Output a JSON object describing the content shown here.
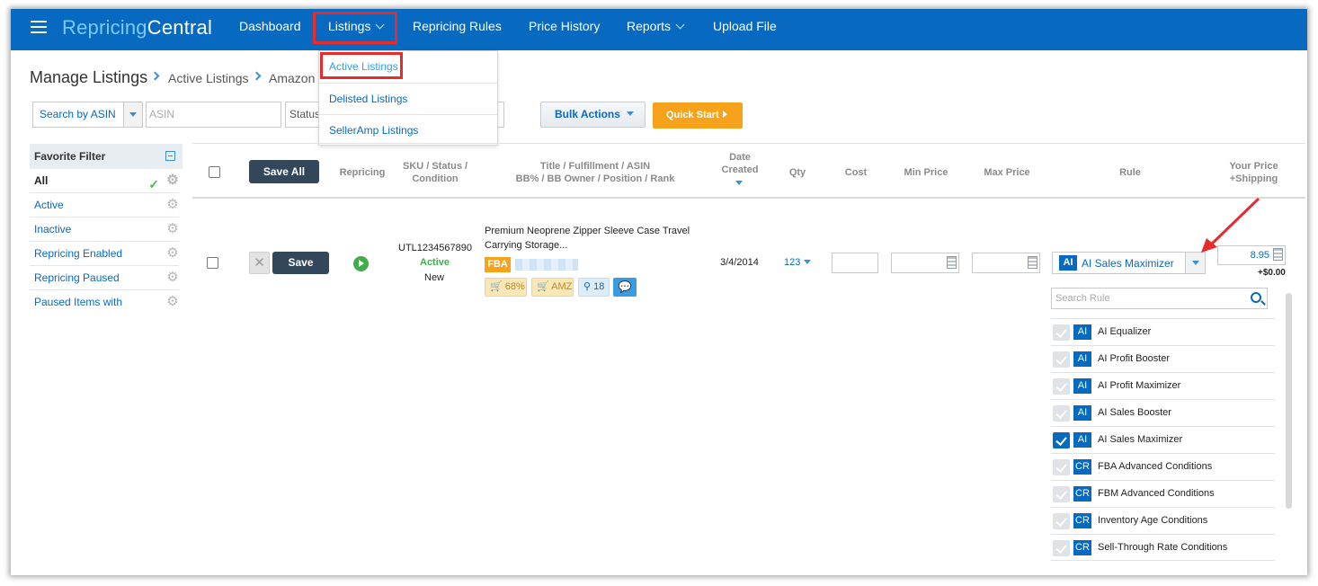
{
  "nav": {
    "logo_part1": "Repricing",
    "logo_part2": "Central",
    "items": [
      "Dashboard",
      "Listings",
      "Repricing Rules",
      "Price History",
      "Reports",
      "Upload File"
    ],
    "listings_dropdown": [
      "Active Listings",
      "Delisted Listings",
      "SellerAmp Listings"
    ]
  },
  "breadcrumb": {
    "title": "Manage Listings",
    "crumbs": [
      "Active Listings",
      "Amazon"
    ]
  },
  "filters": {
    "search_by": "Search by ASIN",
    "asin_placeholder": "ASIN",
    "status": "Status",
    "bulk_actions": "Bulk Actions",
    "quick_start": "Quick Start"
  },
  "favorites": {
    "title": "Favorite Filter",
    "items": [
      "All",
      "Active",
      "Inactive",
      "Repricing Enabled",
      "Repricing Paused",
      "Paused Items with"
    ]
  },
  "table": {
    "save_all": "Save All",
    "headers": {
      "repricing": "Repricing",
      "sku_status_1": "SKU / Status /",
      "sku_status_2": "Condition",
      "title_1": "Title / Fulfillment / ASIN",
      "title_2": "BB% / BB Owner / Position / Rank",
      "date_1": "Date",
      "date_2": "Created",
      "qty": "Qty",
      "cost": "Cost",
      "min_price": "Min Price",
      "max_price": "Max Price",
      "rule": "Rule",
      "price_1": "Your Price",
      "price_2": "+Shipping"
    },
    "row": {
      "save": "Save",
      "x": "✕",
      "sku": "UTL1234567890",
      "status": "Active",
      "condition": "New",
      "title_line1": "Premium Neoprene Zipper Sleeve Case Travel",
      "title_line2": "Carrying Storage...",
      "fulfillment": "FBA",
      "bb_pct": "68%",
      "bb_owner": "AMZ",
      "position": "18",
      "date_created": "3/4/2014",
      "qty": "123",
      "rule_badge": "AI",
      "rule": "AI Sales Maximizer",
      "price": "8.95",
      "shipping": "+$0.00"
    }
  },
  "rule_dropdown": {
    "search_placeholder": "Search Rule",
    "items": [
      {
        "badge": "AI",
        "label": "AI Equalizer",
        "checked": false
      },
      {
        "badge": "AI",
        "label": "AI Profit Booster",
        "checked": false
      },
      {
        "badge": "AI",
        "label": "AI Profit Maximizer",
        "checked": false
      },
      {
        "badge": "AI",
        "label": "AI Sales Booster",
        "checked": false
      },
      {
        "badge": "AI",
        "label": "AI Sales Maximizer",
        "checked": true
      },
      {
        "badge": "CR",
        "label": "FBA Advanced Conditions",
        "checked": false
      },
      {
        "badge": "CR",
        "label": "FBM Advanced Conditions",
        "checked": false
      },
      {
        "badge": "CR",
        "label": "Inventory Age Conditions",
        "checked": false
      },
      {
        "badge": "CR",
        "label": "Sell-Through Rate Conditions",
        "checked": false
      }
    ]
  },
  "colors": {
    "nav_bg": "#0769c0",
    "highlight": "#e52b2b",
    "quick_start": "#f7a21b",
    "fba": "#f7a21b",
    "active_green": "#3fae49"
  }
}
